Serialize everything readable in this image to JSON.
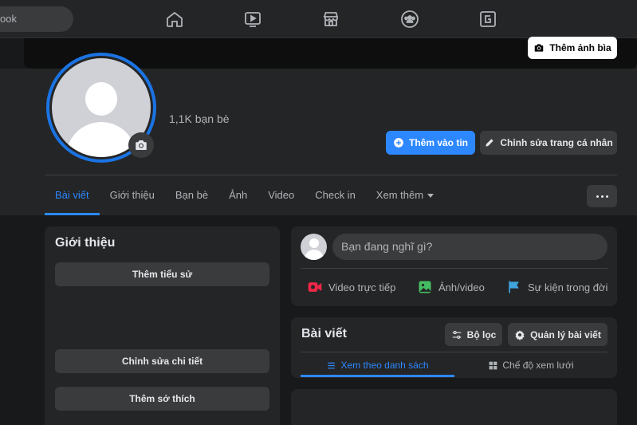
{
  "top_nav": {
    "search_text": "ook",
    "icons": [
      "home-icon",
      "watch-icon",
      "marketplace-icon",
      "groups-icon",
      "gaming-icon"
    ]
  },
  "cover": {
    "add_cover_label": "Thêm ảnh bìa"
  },
  "profile": {
    "friends_count": "1,1K bạn bè",
    "add_story_label": "Thêm vào tin",
    "edit_profile_label": "Chỉnh sửa trang cá nhân"
  },
  "tabs": [
    {
      "label": "Bài viết",
      "active": true
    },
    {
      "label": "Giới thiệu",
      "active": false
    },
    {
      "label": "Bạn bè",
      "active": false
    },
    {
      "label": "Ảnh",
      "active": false
    },
    {
      "label": "Video",
      "active": false
    },
    {
      "label": "Check in",
      "active": false
    },
    {
      "label": "Xem thêm",
      "active": false
    }
  ],
  "intro": {
    "title": "Giới thiệu",
    "add_bio_label": "Thêm tiểu sử",
    "edit_details_label": "Chỉnh sửa chi tiết",
    "add_hobbies_label": "Thêm sở thích"
  },
  "composer": {
    "placeholder": "Bạn đang nghĩ gì?",
    "live_video_label": "Video trực tiếp",
    "photo_video_label": "Ảnh/video",
    "life_event_label": "Sự kiện trong đời"
  },
  "posts": {
    "title": "Bài viết",
    "filter_label": "Bộ lọc",
    "manage_label": "Quản lý bài viết",
    "list_view_label": "Xem theo danh sách",
    "grid_view_label": "Chế độ xem lưới"
  },
  "colors": {
    "accent": "#2d88ff",
    "background": "#18191a",
    "card": "#242526",
    "live_red": "#f02849",
    "photo_green": "#45bd62",
    "event_blue": "#3ea6dd"
  }
}
